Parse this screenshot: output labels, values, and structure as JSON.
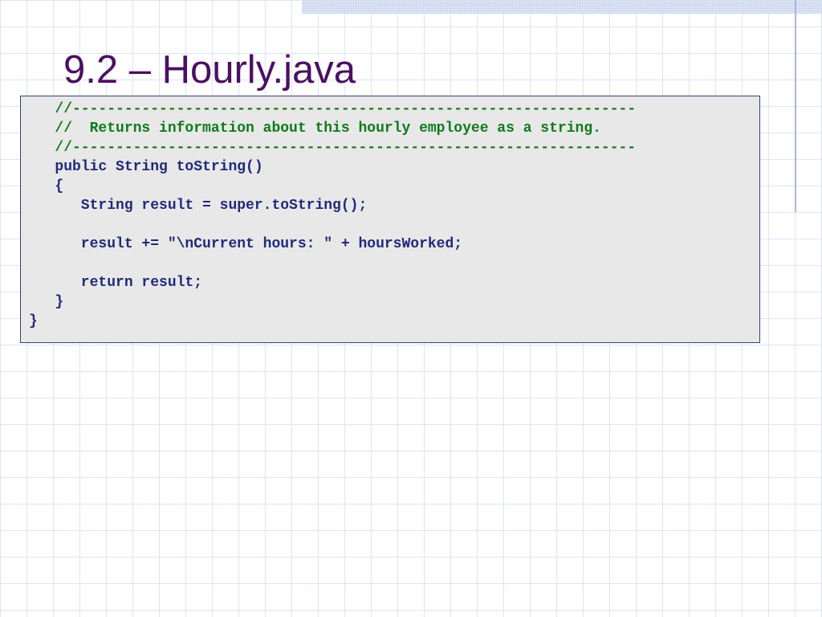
{
  "slide": {
    "title": "9.2 – Hourly.java"
  },
  "code": {
    "lines": [
      {
        "text": "   //-----------------------------------------------------------------",
        "kind": "comment"
      },
      {
        "text": "   //  Returns information about this hourly employee as a string.",
        "kind": "comment"
      },
      {
        "text": "   //-----------------------------------------------------------------",
        "kind": "comment"
      },
      {
        "text": "   public String toString()",
        "kind": "code"
      },
      {
        "text": "   {",
        "kind": "code"
      },
      {
        "text": "      String result = super.toString();",
        "kind": "code"
      },
      {
        "text": "",
        "kind": "code"
      },
      {
        "text": "      result += \"\\nCurrent hours: \" + hoursWorked;",
        "kind": "code"
      },
      {
        "text": "",
        "kind": "code"
      },
      {
        "text": "      return result;",
        "kind": "code"
      },
      {
        "text": "   }",
        "kind": "code"
      },
      {
        "text": "}",
        "kind": "code"
      }
    ]
  },
  "colors": {
    "title": "#4b0f63",
    "code_text": "#1f2a7a",
    "comment_text": "#0f7a1c",
    "code_background": "#e8e8e8",
    "code_border": "#3a3f7a"
  }
}
